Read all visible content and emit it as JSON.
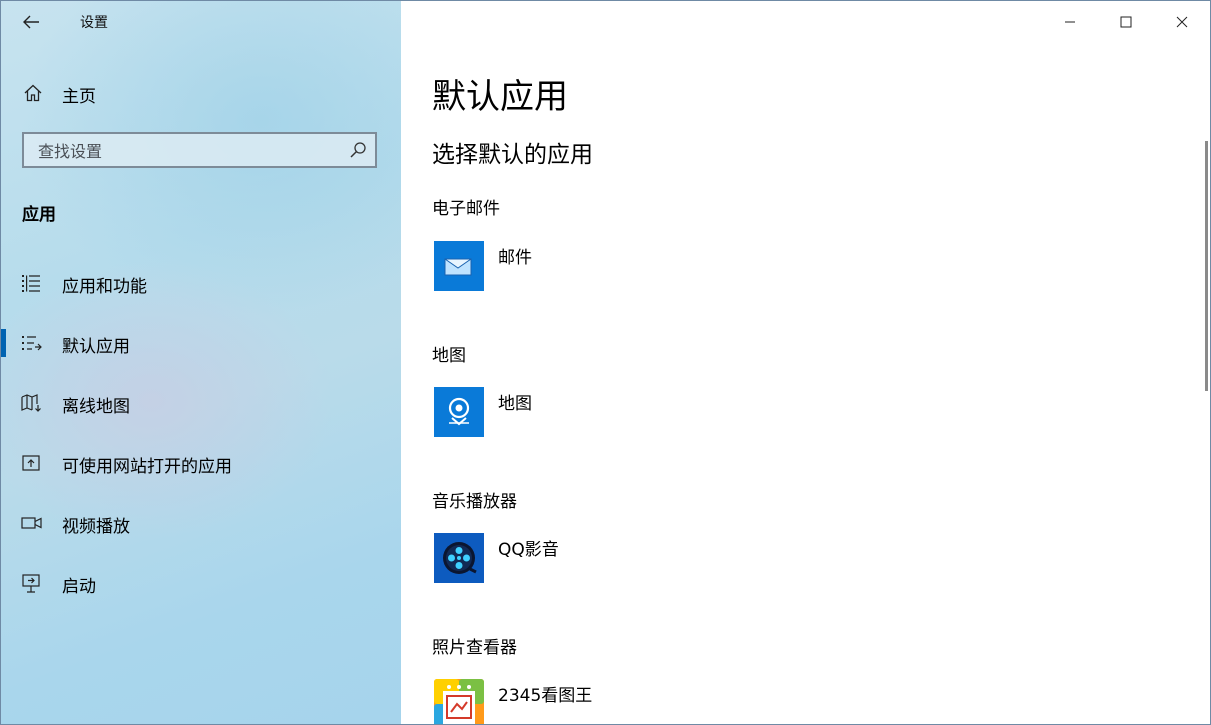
{
  "window": {
    "title": "设置"
  },
  "sidebar": {
    "home_label": "主页",
    "search_placeholder": "查找设置",
    "section_title": "应用",
    "items": [
      {
        "label": "应用和功能",
        "icon": "list-icon"
      },
      {
        "label": "默认应用",
        "icon": "default-apps-icon",
        "active": true
      },
      {
        "label": "离线地图",
        "icon": "offline-map-icon"
      },
      {
        "label": "可使用网站打开的应用",
        "icon": "open-external-icon"
      },
      {
        "label": "视频播放",
        "icon": "video-camera-icon"
      },
      {
        "label": "启动",
        "icon": "startup-icon"
      }
    ]
  },
  "main": {
    "title": "默认应用",
    "subtitle": "选择默认的应用",
    "categories": [
      {
        "label": "电子邮件",
        "app": "邮件",
        "icon": "mail-app-icon"
      },
      {
        "label": "地图",
        "app": "地图",
        "icon": "maps-app-icon"
      },
      {
        "label": "音乐播放器",
        "app": "QQ影音",
        "icon": "qqplayer-app-icon"
      },
      {
        "label": "照片查看器",
        "app": "2345看图王",
        "icon": "photo-viewer-app-icon"
      }
    ]
  },
  "colors": {
    "accent": "#0063b1",
    "tile_blue": "#0a7ad8"
  }
}
